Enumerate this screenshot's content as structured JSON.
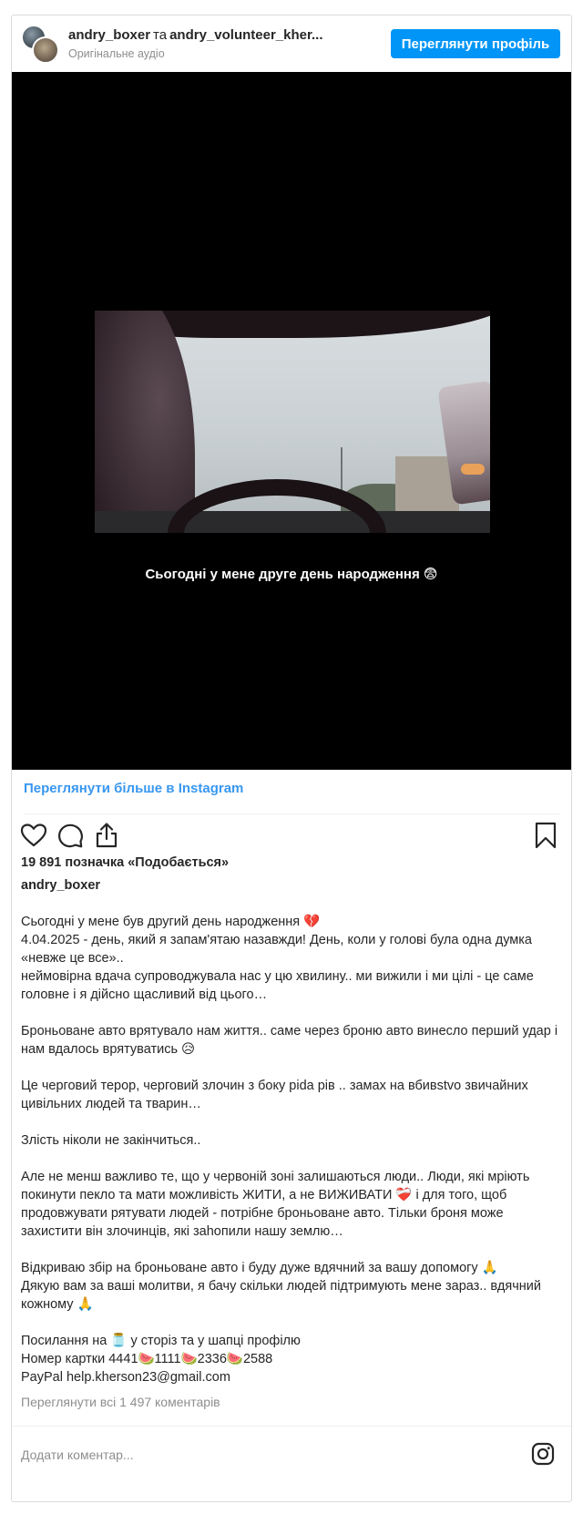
{
  "header": {
    "user1": "andry_boxer",
    "separator": "та",
    "user2": "andry_volunteer_kher...",
    "audio": "Оригінальне аудіо",
    "view_profile": "Переглянути профіль"
  },
  "media": {
    "caption": "Сьогодні у мене друге день народження 😨"
  },
  "view_more": "Переглянути більше в Instagram",
  "icons": {
    "like": "heart-icon",
    "comment": "comment-icon",
    "share": "share-icon",
    "save": "bookmark-icon",
    "instagram": "instagram-icon"
  },
  "likes": "19 891 позначка «Подобається»",
  "author": "andry_boxer",
  "caption_lines": [
    "Сьогодні у мене був другий день народження 💔",
    "4.04.2025 - день, який я запам'ятаю назавжди! День, коли у голові була одна думка «невже це все»..",
    "неймовірна вдача супроводжувала нас у цю хвилину.. ми вижили і ми цілі - це саме головне і я дійсно щасливий від цього…",
    "",
    "Броньоване авто врятувало нам життя.. саме через броню авто винесло перший удар і нам вдалось врятуватись 😥",
    "",
    "Це черговий терор, черговий злочин з боку pida рів .. замах на вбивstvo звичайних цивільних людей та тварин…",
    "",
    "Злість ніколи не закінчиться..",
    "",
    "Але не менш важливо те, що у червоній зоні залишаються люди.. Люди, які мріють покинути пекло та мати можливість ЖИТИ, а не ВИЖИВАТИ ❤️‍🩹 і для того, щоб продовжувати рятувати людей - потрібне броньоване авто. Тільки броня може захистити він злочинців, які заhопили нашу землю…",
    "",
    "Відкриваю збір на броньоване авто і буду дуже вдячний за вашу допомогу 🙏",
    "Дякую вам за ваші молитви, я бачу скільки людей підтримують мене зараз.. вдячний кожному 🙏",
    "",
    "Посилання на 🫙 у сторіз та у шапці профілю",
    "Номер картки 4441🍉1111🍉2336🍉2588",
    "PayPal help.kherson23@gmail.com"
  ],
  "comments": "Переглянути всі 1 497 коментарів",
  "add_comment": "Додати коментар..."
}
